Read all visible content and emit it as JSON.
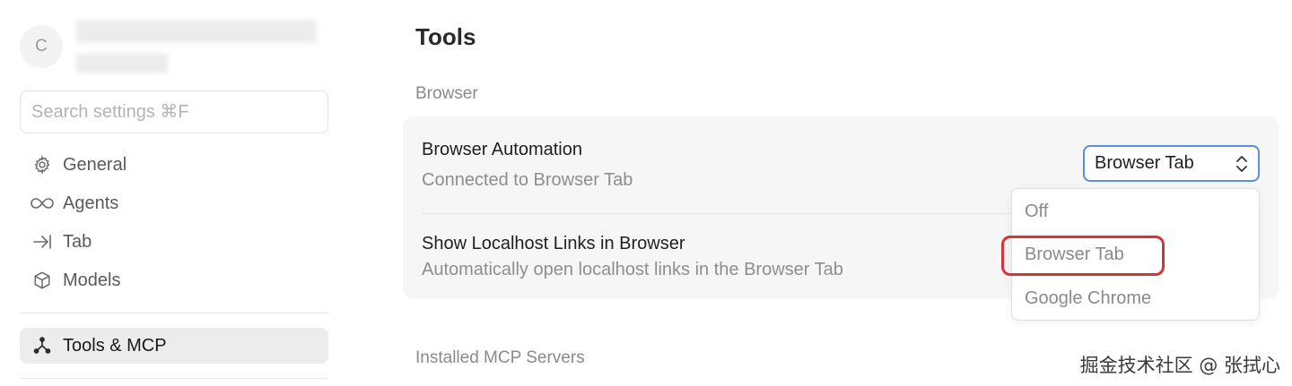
{
  "sidebar": {
    "avatar_initial": "C",
    "search": {
      "placeholder": "Search settings ⌘F"
    },
    "items": [
      {
        "label": "General",
        "icon": "gear-icon"
      },
      {
        "label": "Agents",
        "icon": "infinity-icon"
      },
      {
        "label": "Tab",
        "icon": "arrow-to-line-icon"
      },
      {
        "label": "Models",
        "icon": "cube-icon"
      },
      {
        "label": "Tools & MCP",
        "icon": "tools-nodes-icon",
        "active": true
      }
    ]
  },
  "main": {
    "title": "Tools",
    "browser_section": {
      "label": "Browser",
      "automation": {
        "title": "Browser Automation",
        "subtitle": "Connected to Browser Tab",
        "selected": "Browser Tab",
        "options": [
          "Off",
          "Browser Tab",
          "Google Chrome"
        ]
      },
      "localhost": {
        "title": "Show Localhost Links in Browser",
        "subtitle": "Automatically open localhost links in the Browser Tab"
      }
    },
    "mcp_section": {
      "label": "Installed MCP Servers"
    }
  },
  "watermark": "掘金技术社区 @ 张拭心",
  "colors": {
    "focus_border": "#5b8fd8",
    "annotation_ring": "#d8323a",
    "card_bg": "#f6f6f6",
    "active_nav_bg": "#ececec"
  }
}
